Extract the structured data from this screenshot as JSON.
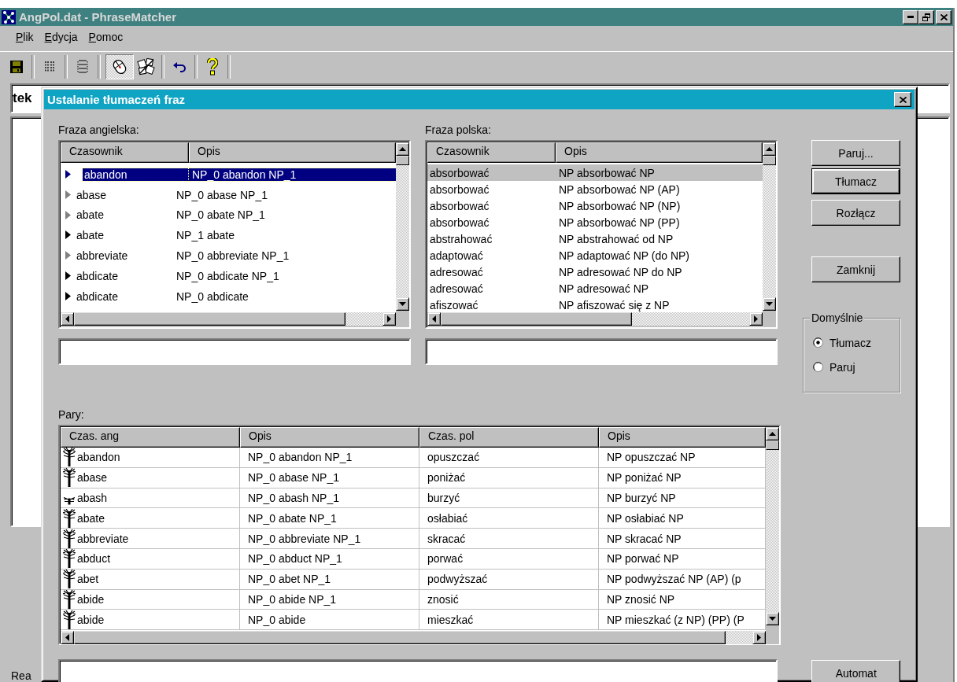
{
  "window": {
    "title": "AngPol.dat - PhraseMatcher"
  },
  "menu": [
    "Plik",
    "Edycja",
    "Pomoc"
  ],
  "toolbar": [
    {
      "kind": "save",
      "pressed": false
    },
    {
      "kind": "separator"
    },
    {
      "kind": "columns",
      "pressed": false
    },
    {
      "kind": "separator"
    },
    {
      "kind": "rows",
      "pressed": false
    },
    {
      "kind": "separator"
    },
    {
      "kind": "mouse",
      "pressed": true
    },
    {
      "kind": "dice",
      "pressed": false
    },
    {
      "kind": "separator"
    },
    {
      "kind": "undo",
      "pressed": false
    },
    {
      "kind": "separator"
    },
    {
      "kind": "help",
      "pressed": false
    },
    {
      "kind": "separator"
    }
  ],
  "text_field": {
    "value": "tek"
  },
  "status_bar": {
    "text": "Rea"
  },
  "dialog": {
    "title": "Ustalanie tłumaczeń fraz",
    "english": {
      "label": "Fraza angielska:",
      "columns": [
        "Czasownik",
        "Opis"
      ],
      "rows": [
        {
          "verb": "abandon",
          "desc": "NP_0 abandon NP_1",
          "color": "#000080",
          "selected": true
        },
        {
          "verb": "abase",
          "desc": "NP_0 abase NP_1",
          "color": "#808080",
          "selected": false
        },
        {
          "verb": "abate",
          "desc": "NP_0 abate NP_1",
          "color": "#808080",
          "selected": false
        },
        {
          "verb": "abate",
          "desc": "NP_1 abate",
          "color": "#000000",
          "selected": false
        },
        {
          "verb": "abbreviate",
          "desc": "NP_0 abbreviate NP_1",
          "color": "#808080",
          "selected": false
        },
        {
          "verb": "abdicate",
          "desc": "NP_0 abdicate NP_1",
          "color": "#000000",
          "selected": false
        },
        {
          "verb": "abdicate",
          "desc": "NP_0 abdicate",
          "color": "#000000",
          "selected": false
        }
      ]
    },
    "polish": {
      "label": "Fraza polska:",
      "columns": [
        "Czasownik",
        "Opis"
      ],
      "rows": [
        {
          "verb": "absorbować",
          "desc": "NP absorbować NP",
          "selected": true
        },
        {
          "verb": "absorbować",
          "desc": "NP absorbować NP (AP)",
          "selected": false
        },
        {
          "verb": "absorbować",
          "desc": "NP absorbować NP (NP)",
          "selected": false
        },
        {
          "verb": "absorbować",
          "desc": "NP absorbować NP (PP)",
          "selected": false
        },
        {
          "verb": "abstrahować",
          "desc": "NP abstrahować od NP",
          "selected": false
        },
        {
          "verb": "adaptować",
          "desc": "NP adaptować NP (do NP)",
          "selected": false
        },
        {
          "verb": "adresować",
          "desc": "NP adresować NP do NP",
          "selected": false
        },
        {
          "verb": "adresować",
          "desc": "NP adresować NP",
          "selected": false
        },
        {
          "verb": "afiszować",
          "desc": "NP afiszować się z NP",
          "selected": false
        }
      ]
    },
    "pairs": {
      "label": "Pary:",
      "columns": [
        "Czas. ang",
        "Opis",
        "Czas. pol",
        "Opis"
      ],
      "rows": [
        {
          "kind": "tree",
          "cells": [
            "abandon",
            "NP_0 abandon NP_1",
            "opuszczać",
            "NP opuszczać NP"
          ]
        },
        {
          "kind": "tree",
          "cells": [
            "abase",
            "NP_0 abase NP_1",
            "poniżać",
            "NP poniżać NP"
          ]
        },
        {
          "kind": "sprout",
          "cells": [
            "abash",
            "NP_0 abash NP_1",
            "burzyć",
            "NP burzyć NP"
          ]
        },
        {
          "kind": "tree",
          "cells": [
            "abate",
            "NP_0 abate NP_1",
            "osłabiać",
            "NP osłabiać NP"
          ]
        },
        {
          "kind": "tree",
          "cells": [
            "abbreviate",
            "NP_0 abbreviate NP_1",
            "skracać",
            "NP skracać NP"
          ]
        },
        {
          "kind": "tree",
          "cells": [
            "abduct",
            "NP_0 abduct NP_1",
            "porwać",
            "NP porwać NP"
          ]
        },
        {
          "kind": "tree",
          "cells": [
            "abet",
            "NP_0 abet NP_1",
            "podwyższać",
            "NP podwyższać NP (AP) (p"
          ]
        },
        {
          "kind": "tree",
          "cells": [
            "abide",
            "NP_0 abide NP_1",
            "znosić",
            "NP znosić NP"
          ]
        },
        {
          "kind": "tree",
          "cells": [
            "abide",
            "NP_0 abide",
            "mieszkać",
            "NP mieszkać (z NP) (PP) (P"
          ]
        }
      ]
    },
    "buttons": [
      {
        "label": "Paruj...",
        "default": false
      },
      {
        "label": "Tłumacz",
        "default": true
      },
      {
        "label": "Rozłącz",
        "default": false
      },
      {
        "label": "Zamknij",
        "default": false
      }
    ],
    "defaults": {
      "label": "Domyślnie",
      "options": [
        {
          "label": "Tłumacz",
          "selected": true
        },
        {
          "label": "Paruj",
          "selected": false
        }
      ]
    },
    "automat_button": {
      "label": "Automat"
    }
  }
}
